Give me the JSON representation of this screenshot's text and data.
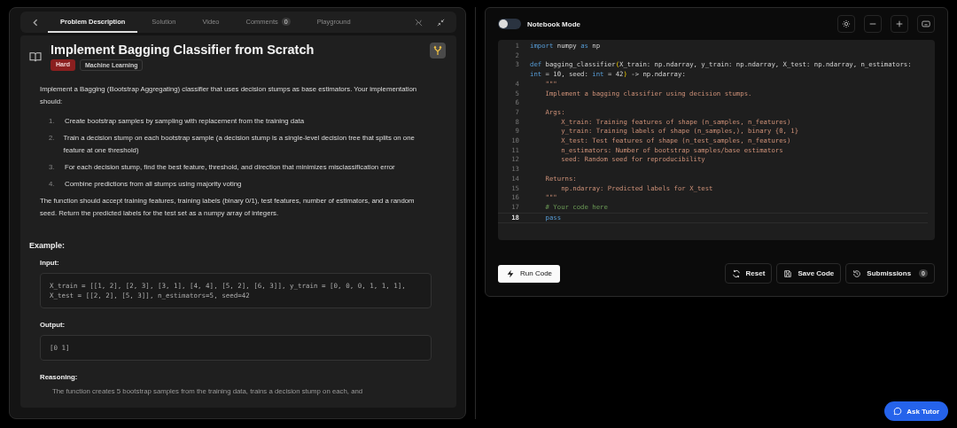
{
  "tabs": [
    {
      "label": "Problem Description",
      "selected": true
    },
    {
      "label": "Solution",
      "selected": false
    },
    {
      "label": "Video",
      "selected": false
    },
    {
      "label": "Comments",
      "selected": false,
      "count": "0"
    },
    {
      "label": "Playground",
      "selected": false
    }
  ],
  "problem": {
    "title": "Implement Bagging Classifier from Scratch",
    "difficulty": "Hard",
    "tag": "Machine Learning",
    "intro": "Implement a Bagging (Bootstrap Aggregating) classifier that uses decision stumps as base estimators. Your implementation should:",
    "steps": [
      {
        "num": "1.",
        "text": "Create bootstrap samples by sampling with replacement from the training data"
      },
      {
        "num": "2.",
        "text": "Train a decision stump on each bootstrap sample (a decision stump is a single-level decision tree that splits on one feature at one threshold)"
      },
      {
        "num": "3.",
        "text": "For each decision stump, find the best feature, threshold, and direction that minimizes misclassification error"
      },
      {
        "num": "4.",
        "text": "Combine predictions from all stumps using majority voting"
      }
    ],
    "outro": "The function should accept training features, training labels (binary 0/1), test features, number of estimators, and a random seed. Return the predicted labels for the test set as a numpy array of integers.",
    "example": {
      "heading": "Example:",
      "input_label": "Input:",
      "input": "X_train = [[1, 2], [2, 3], [3, 1], [4, 4], [5, 2], [6, 3]], y_train = [0, 0, 0, 1, 1, 1], X_test = [[2, 2], [5, 3]], n_estimators=5, seed=42",
      "output_label": "Output:",
      "output": "[0 1]",
      "reasoning_label": "Reasoning:",
      "reasoning": "The function creates 5 bootstrap samples from the training data, trains a decision stump on each, and"
    }
  },
  "notebook_mode": {
    "label": "Notebook Mode",
    "on": false
  },
  "code": [
    {
      "num": "1",
      "current": false,
      "segments": [
        {
          "kind": "keyword",
          "text": "import"
        },
        {
          "kind": "plain",
          "text": " numpy "
        },
        {
          "kind": "keyword",
          "text": "as"
        },
        {
          "kind": "plain",
          "text": " np"
        }
      ]
    },
    {
      "num": "2",
      "current": false
    },
    {
      "num": "3",
      "current": false,
      "segments": [
        {
          "kind": "keyword",
          "text": "def"
        },
        {
          "kind": "plain",
          "text": " bagging_classifier"
        },
        {
          "kind": "bracket",
          "text": "("
        },
        {
          "kind": "plain",
          "text": "X_train: np.ndarray, y_train: np.ndarray, X_test: np.ndarray, n_estimators: "
        },
        {
          "kind": "keyword",
          "text": "int"
        },
        {
          "kind": "plain",
          "text": " = 10, seed: "
        },
        {
          "kind": "keyword",
          "text": "int"
        },
        {
          "kind": "plain",
          "text": " = 42"
        },
        {
          "kind": "bracket",
          "text": ")"
        },
        {
          "kind": "plain",
          "text": " -> np.ndarray:"
        }
      ]
    },
    {
      "num": "4",
      "current": false,
      "segments": [
        {
          "kind": "string",
          "text": "    \"\"\""
        }
      ]
    },
    {
      "num": "5",
      "current": false,
      "segments": [
        {
          "kind": "string",
          "text": "    Implement a bagging classifier using decision stumps."
        }
      ]
    },
    {
      "num": "6",
      "current": false
    },
    {
      "num": "7",
      "current": false,
      "segments": [
        {
          "kind": "string",
          "text": "    Args:"
        }
      ]
    },
    {
      "num": "8",
      "current": false,
      "segments": [
        {
          "kind": "string",
          "text": "        X_train: Training features of shape (n_samples, n_features)"
        }
      ]
    },
    {
      "num": "9",
      "current": false,
      "segments": [
        {
          "kind": "string",
          "text": "        y_train: Training labels of shape (n_samples,), binary {0, 1}"
        }
      ]
    },
    {
      "num": "10",
      "current": false,
      "segments": [
        {
          "kind": "string",
          "text": "        X_test: Test features of shape (n_test_samples, n_features)"
        }
      ]
    },
    {
      "num": "11",
      "current": false,
      "segments": [
        {
          "kind": "string",
          "text": "        n_estimators: Number of bootstrap samples/base estimators"
        }
      ]
    },
    {
      "num": "12",
      "current": false,
      "segments": [
        {
          "kind": "string",
          "text": "        seed: Random seed for reproducibility"
        }
      ]
    },
    {
      "num": "13",
      "current": false
    },
    {
      "num": "14",
      "current": false,
      "segments": [
        {
          "kind": "string",
          "text": "    Returns:"
        }
      ]
    },
    {
      "num": "15",
      "current": false,
      "segments": [
        {
          "kind": "string",
          "text": "        np.ndarray: Predicted labels for X_test"
        }
      ]
    },
    {
      "num": "16",
      "current": false,
      "segments": [
        {
          "kind": "string",
          "text": "    \"\"\""
        }
      ]
    },
    {
      "num": "17",
      "current": false,
      "segments": [
        {
          "kind": "comment",
          "text": "    # Your code here"
        }
      ]
    },
    {
      "num": "18",
      "current": true,
      "segments": [
        {
          "kind": "keyword",
          "text": "    pass"
        }
      ]
    }
  ],
  "run_button": "Run Code",
  "actions": [
    {
      "kind": "reset",
      "label": "Reset"
    },
    {
      "kind": "save",
      "label": "Save Code"
    },
    {
      "kind": "history",
      "label": "Submissions",
      "count": "0"
    }
  ],
  "ask_tutor": "Ask Tutor"
}
